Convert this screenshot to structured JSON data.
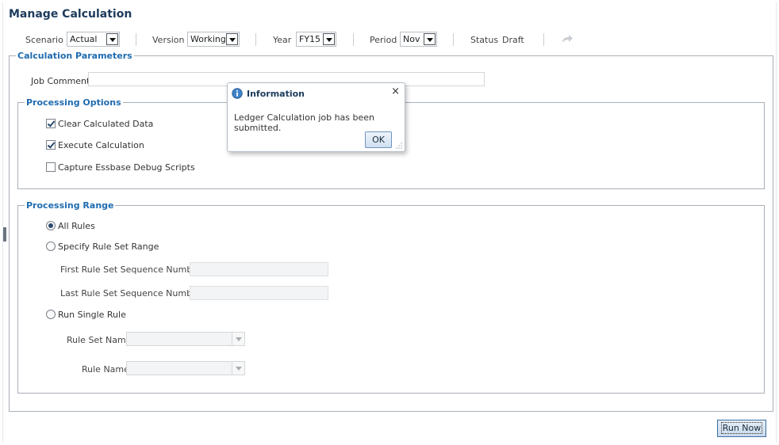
{
  "page": {
    "title": "Manage Calculation"
  },
  "toolbar": {
    "scenario_label": "Scenario",
    "scenario_value": "Actual",
    "version_label": "Version",
    "version_value": "Working",
    "year_label": "Year",
    "year_value": "FY15",
    "period_label": "Period",
    "period_value": "Nov",
    "status_label": "Status",
    "status_value": "Draft",
    "redo_icon": "redo-arrow-icon"
  },
  "calc_params": {
    "legend": "Calculation Parameters",
    "job_comment_label": "Job Comment",
    "job_comment_value": ""
  },
  "processing_options": {
    "legend": "Processing Options",
    "items": [
      {
        "label": "Clear Calculated Data",
        "checked": true
      },
      {
        "label": "Execute Calculation",
        "checked": true
      },
      {
        "label": "Capture Essbase Debug Scripts",
        "checked": false
      }
    ]
  },
  "processing_range": {
    "legend": "Processing Range",
    "all_rules": "All Rules",
    "specify_range": "Specify Rule Set Range",
    "first_seq_label": "First Rule Set Sequence Number",
    "last_seq_label": "Last Rule Set Sequence Number",
    "run_single": "Run Single Rule",
    "rule_set_name_label": "Rule Set Name",
    "rule_name_label": "Rule Name",
    "selected": "All Rules"
  },
  "actions": {
    "run_now": "Run Now"
  },
  "dialog": {
    "title": "Information",
    "message": "Ledger Calculation job has been submitted.",
    "ok": "OK",
    "close_icon": "close-icon",
    "info_icon": "info-icon"
  },
  "colors": {
    "title": "#1d3b5c",
    "legend": "#1f6bb0",
    "accent": "#3b6ea3"
  }
}
